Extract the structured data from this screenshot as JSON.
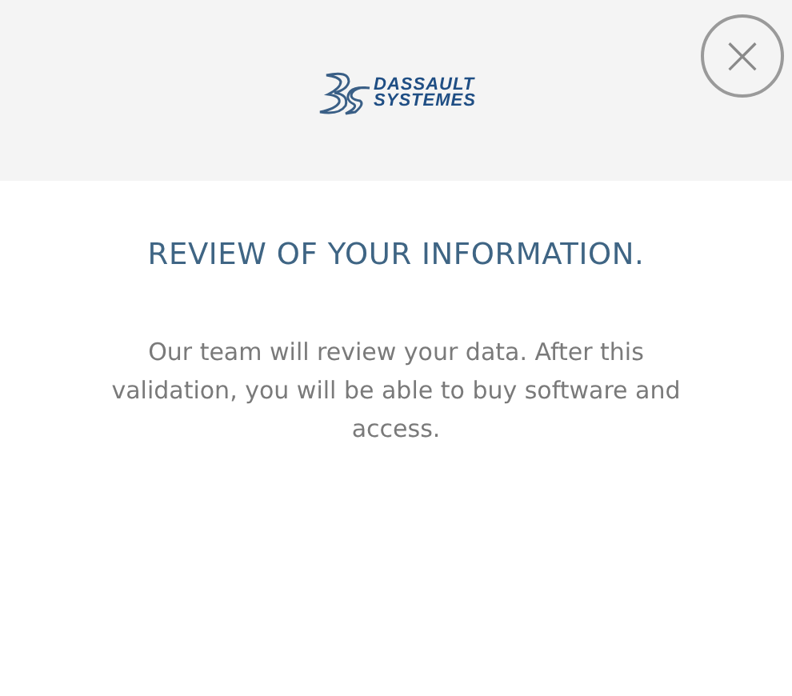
{
  "header": {
    "logo": {
      "line_1": "DASSAULT",
      "line_2": "SYSTEMES"
    },
    "close": {
      "label": "×"
    }
  },
  "title": "REVIEW OF YOUR INFORMATION.",
  "message": "Our team will review your data. After this validation, you will be able to buy software and access."
}
